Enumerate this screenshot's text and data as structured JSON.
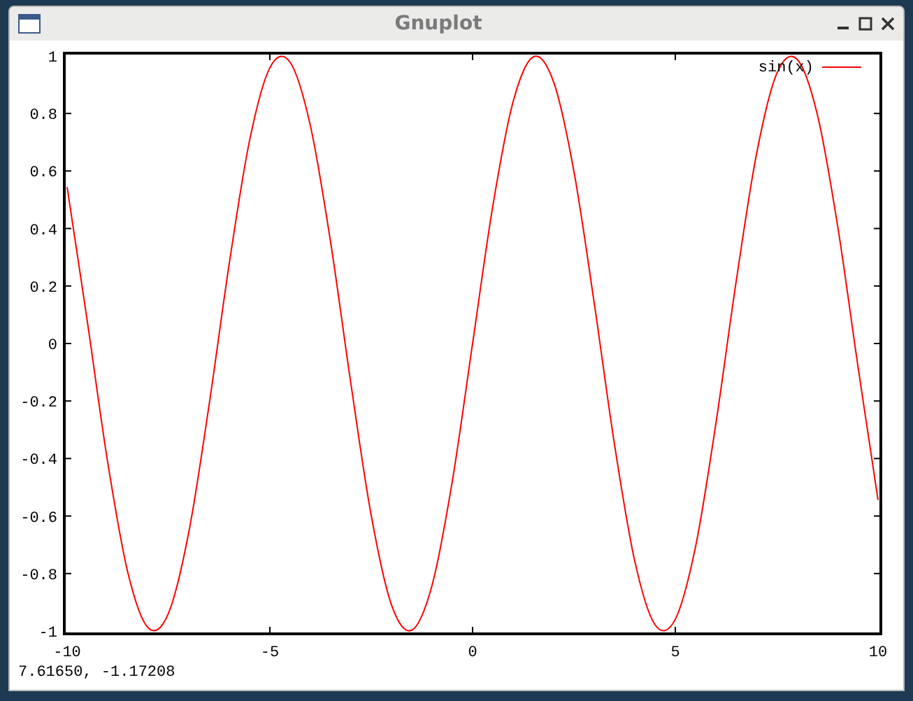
{
  "window": {
    "title": "Gnuplot"
  },
  "plot": {
    "chart_data": {
      "type": "line",
      "x": [
        -10,
        -9.5,
        -9,
        -8.5,
        -8,
        -7.5,
        -7,
        -6.5,
        -6,
        -5.5,
        -5,
        -4.5,
        -4,
        -3.5,
        -3,
        -2.5,
        -2,
        -1.5,
        -1,
        -0.5,
        0,
        0.5,
        1,
        1.5,
        2,
        2.5,
        3,
        3.5,
        4,
        4.5,
        5,
        5.5,
        6,
        6.5,
        7,
        7.5,
        8,
        8.5,
        9,
        9.5,
        10
      ],
      "series": [
        {
          "name": "sin(x)",
          "color": "#ff0000",
          "values": [
            0.544,
            0.075,
            -0.412,
            -0.798,
            -0.989,
            -0.938,
            -0.657,
            -0.215,
            0.279,
            0.706,
            0.959,
            0.978,
            0.757,
            0.351,
            -0.141,
            -0.598,
            -0.909,
            -0.997,
            -0.841,
            -0.479,
            0,
            0.479,
            0.841,
            0.997,
            0.909,
            0.598,
            0.141,
            -0.351,
            -0.757,
            -0.978,
            -0.959,
            -0.706,
            -0.279,
            0.215,
            0.657,
            0.938,
            0.989,
            0.798,
            0.412,
            -0.075,
            -0.544
          ]
        }
      ],
      "xlim": [
        -10,
        10
      ],
      "ylim": [
        -1,
        1
      ],
      "xticks": [
        -10,
        -5,
        0,
        5,
        10
      ],
      "yticks": [
        -1,
        -0.8,
        -0.6,
        -0.4,
        -0.2,
        0,
        0.2,
        0.4,
        0.6,
        0.8,
        1
      ]
    }
  },
  "status_bar": {
    "text": "7.61650, -1.17208"
  }
}
